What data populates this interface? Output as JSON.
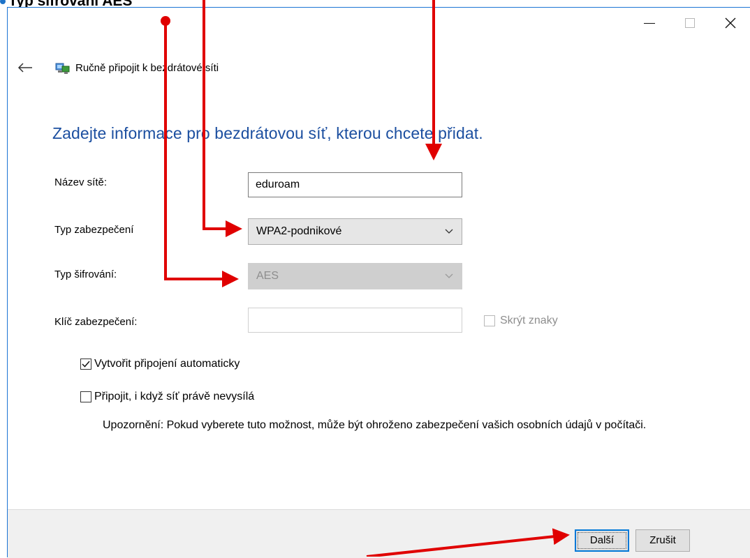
{
  "caption": "Typ šifrování AES",
  "window": {
    "controls": {
      "minimize": "—",
      "maximize": "□",
      "close": "✕"
    }
  },
  "header": {
    "title": "Ručně připojit k bezdrátové síti"
  },
  "instruction": "Zadejte informace pro bezdrátovou síť, kterou chcete přidat.",
  "form": {
    "network_name": {
      "label": "Název sítě:",
      "value": "eduroam"
    },
    "security_type": {
      "label": "Typ zabezpečení",
      "value": "WPA2-podnikové"
    },
    "encryption_type": {
      "label": "Typ šifrování:",
      "value": "AES"
    },
    "security_key": {
      "label": "Klíč zabezpečení:",
      "value": ""
    },
    "hide_characters": {
      "label": "Skrýt znaky",
      "checked": false
    }
  },
  "options": {
    "auto_connect": {
      "label": "Vytvořit připojení automaticky",
      "checked": true
    },
    "connect_hidden": {
      "label": "Připojit, i když síť právě nevysílá",
      "checked": false
    }
  },
  "warning": "Upozornění: Pokud vyberete tuto možnost, může být ohroženo zabezpečení vašich osobních údajů v počítači.",
  "footer": {
    "next_label": "Další",
    "cancel_label": "Zrušit"
  },
  "colors": {
    "accent": "#0078d7",
    "heading": "#1c4fa0",
    "annotation": "#e00000"
  }
}
